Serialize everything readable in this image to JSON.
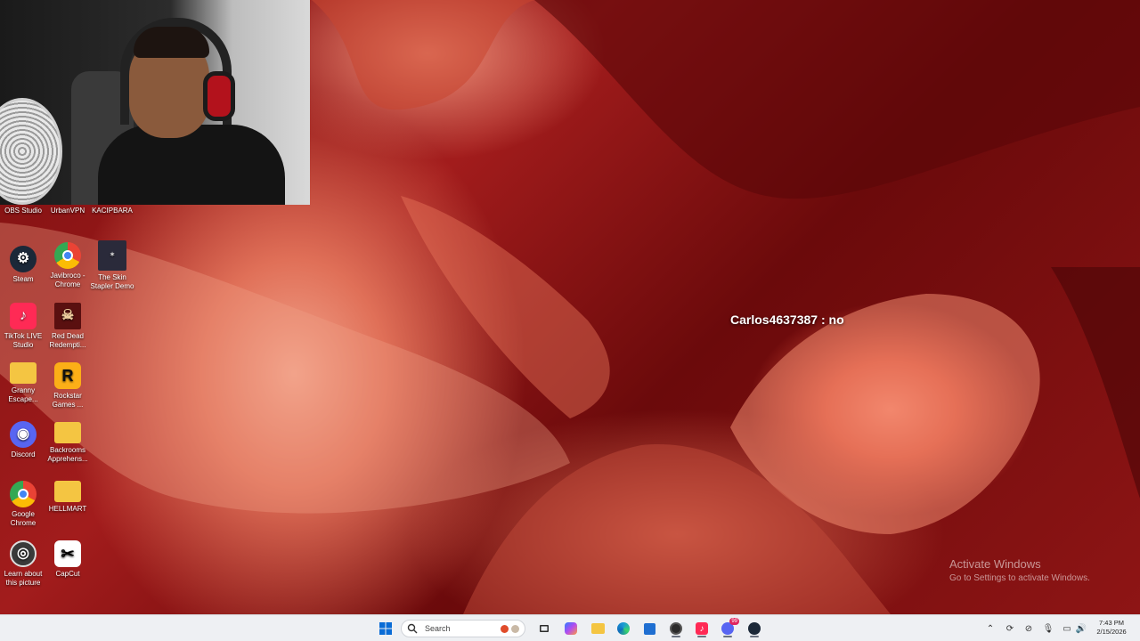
{
  "desktop": {
    "icons": [
      {
        "label": "OBS Studio",
        "icon": "obs-icon"
      },
      {
        "label": "UrbanVPN",
        "icon": "urbanvpn-icon"
      },
      {
        "label": "KACIPBARA",
        "icon": "kacipbara-icon"
      },
      {
        "label": "Steam",
        "icon": "steam-icon"
      },
      {
        "label": "Javibroco - Chrome",
        "icon": "chrome-profile-icon"
      },
      {
        "label": "The Skin Stapler Demo",
        "icon": "game-icon"
      },
      {
        "label": "TikTok LIVE Studio",
        "icon": "tiktok-icon"
      },
      {
        "label": "Red Dead Redempti...",
        "icon": "rdr-icon"
      },
      {
        "label": "Granny Escape...",
        "icon": "folder-icon"
      },
      {
        "label": "Rockstar Games ...",
        "icon": "rockstar-icon"
      },
      {
        "label": "Discord",
        "icon": "discord-icon"
      },
      {
        "label": "Backrooms Apprehens...",
        "icon": "folder-icon"
      },
      {
        "label": "Google Chrome",
        "icon": "chrome-icon"
      },
      {
        "label": "HELLMART",
        "icon": "folder-icon"
      },
      {
        "label": "Learn about this picture",
        "icon": "spotlight-icon"
      },
      {
        "label": "CapCut",
        "icon": "capcut-icon"
      }
    ]
  },
  "overlay": {
    "chat_message": "Carlos4637387 : no"
  },
  "watermark": {
    "title": "Activate Windows",
    "subtitle": "Go to Settings to activate Windows."
  },
  "taskbar": {
    "search_placeholder": "Search",
    "pinned": [
      "start-icon",
      "task-view-icon",
      "copilot-icon",
      "file-explorer-icon",
      "edge-icon",
      "store-icon",
      "obs-taskbar-icon",
      "tiktok-taskbar-icon",
      "discord-taskbar-icon",
      "steam-taskbar-icon"
    ],
    "discord_badge": "99"
  },
  "tray": {
    "time": "7:43 PM",
    "date": "2/15/2026"
  },
  "colors": {
    "taskbar_bg": "#eef0f3",
    "windows_blue": "#0a6cd6",
    "wallpaper_dark": "#7a0f10"
  }
}
